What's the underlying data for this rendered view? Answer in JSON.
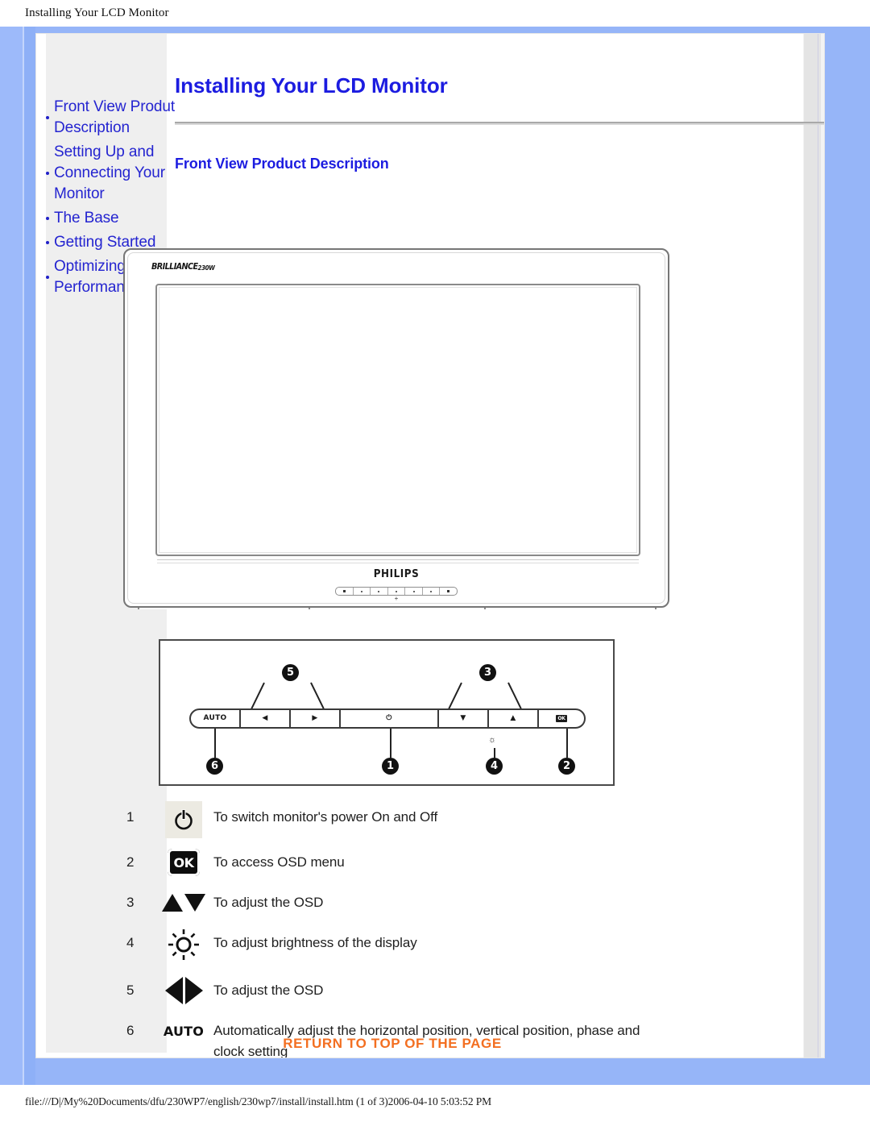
{
  "browser": {
    "header_title": "Installing Your LCD Monitor",
    "footer_path": "file:///D|/My%20Documents/dfu/230WP7/english/230wp7/install/install.htm (1 of 3)2006-04-10 5:03:52 PM"
  },
  "colors": {
    "page_blue": "#96b5f8",
    "sidebar_gray": "#efefef",
    "link_blue": "#2424d0",
    "heading_blue": "#1c1ce0",
    "accent_orange": "#f36f21"
  },
  "sidebar": {
    "items": [
      {
        "label": "Front View Produt Description"
      },
      {
        "label": "Setting Up and Connecting Your Monitor"
      },
      {
        "label": "The Base"
      },
      {
        "label": "Getting Started"
      },
      {
        "label": "Optimizing Performance"
      }
    ]
  },
  "main": {
    "page_title": "Installing Your LCD Monitor",
    "section_title": "Front View Product Description",
    "return_link": "RETURN TO TOP OF THE PAGE"
  },
  "monitor_figure": {
    "brand_logo": "BRILLIANCE",
    "model_badge": "230W",
    "wordmark": "PHILIPS"
  },
  "control_panel": {
    "keys": [
      {
        "id": "auto",
        "label": "AUTO"
      },
      {
        "id": "left",
        "label": "◀"
      },
      {
        "id": "right",
        "label": "▶"
      },
      {
        "id": "power",
        "label": "⏻"
      },
      {
        "id": "down",
        "label": "▼"
      },
      {
        "id": "up",
        "label": "▲"
      },
      {
        "id": "ok",
        "label": "OK"
      }
    ],
    "callouts": [
      {
        "num": "5",
        "position": "top-left"
      },
      {
        "num": "3",
        "position": "top-right"
      },
      {
        "num": "6",
        "position": "bottom-auto"
      },
      {
        "num": "1",
        "position": "bottom-power"
      },
      {
        "num": "4",
        "position": "bottom-brightness"
      },
      {
        "num": "2",
        "position": "bottom-ok"
      }
    ]
  },
  "legend": {
    "rows": [
      {
        "num": "1",
        "icon": "power-icon",
        "desc": "To switch monitor's power On and Off"
      },
      {
        "num": "2",
        "icon": "ok-icon",
        "desc": "To access OSD menu"
      },
      {
        "num": "3",
        "icon": "up-down-icon",
        "desc": "To adjust the OSD"
      },
      {
        "num": "4",
        "icon": "brightness-icon",
        "desc": "To adjust brightness of the display"
      },
      {
        "num": "5",
        "icon": "left-right-icon",
        "desc": "To adjust the OSD"
      },
      {
        "num": "6",
        "icon": "auto-icon",
        "desc": "Automatically adjust the horizontal position, vertical position, phase and clock setting"
      }
    ],
    "auto_label": "AUTO",
    "ok_label": "OK"
  }
}
